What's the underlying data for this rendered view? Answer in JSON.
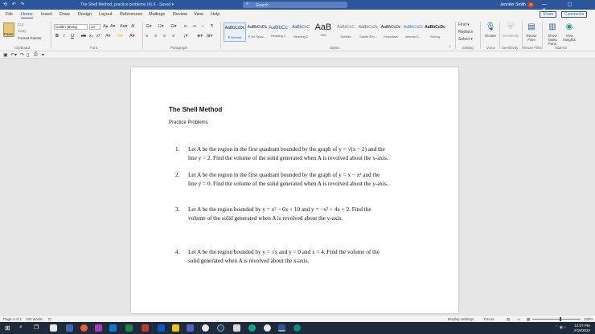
{
  "titlebar": {
    "quick_access": "⟲ ↶ ↷",
    "filename": "The Shell Method_practice problems (4).X  -  Saved ▾",
    "search_placeholder": "Search",
    "user": "Jennifer Smith",
    "avatar_initials": "JS",
    "window_buttons": "— ▢ ✕"
  },
  "menu_tabs": [
    "File",
    "Home",
    "Insert",
    "Draw",
    "Design",
    "Layout",
    "References",
    "Mailings",
    "Review",
    "View",
    "Help"
  ],
  "actions": {
    "share": "Share",
    "comments": "Comments"
  },
  "ribbon": {
    "clipboard": {
      "paste": "Paste",
      "cut": "Cut",
      "copy": "Copy",
      "format_painter": "Format Painter",
      "label": "Clipboard"
    },
    "font": {
      "name": "Calibri (Body)",
      "size": "12",
      "label": "Font",
      "format_buttons": [
        "B",
        "I",
        "U",
        "ab",
        "x₂",
        "x²"
      ]
    },
    "paragraph": {
      "label": "Paragraph"
    },
    "styles": {
      "label": "Styles",
      "items": [
        {
          "preview": "AaBbCcDc",
          "name": "¶ Normal"
        },
        {
          "preview": "AaBbCcDc",
          "name": "¶ No Spac..."
        },
        {
          "preview": "AaBbCc",
          "name": "Heading 1"
        },
        {
          "preview": "AaBbCcC",
          "name": "Heading 2"
        },
        {
          "preview": "AaB",
          "name": "Title"
        },
        {
          "preview": "AaBbCcC",
          "name": "Subtitle"
        },
        {
          "preview": "AaBbCcDc",
          "name": "Subtle Em..."
        },
        {
          "preview": "AaBbCcDc",
          "name": "Emphasis"
        },
        {
          "preview": "AaBbCcDc",
          "name": "Intense E..."
        },
        {
          "preview": "AaBbCcDc",
          "name": "Strong"
        }
      ]
    },
    "editing": {
      "find": "Find ▾",
      "replace": "Replace",
      "select": "Select ▾",
      "label": "Editing"
    },
    "voice": {
      "dictate": "Dictate",
      "label": "Voice"
    },
    "sensitivity": {
      "button": "Sensitivity",
      "label": "Sensitivity"
    },
    "reuse": {
      "button": "Reuse Files",
      "label": "Reuse Files"
    },
    "addins": {
      "show_tasks": "Show Tasks Pane",
      "viva": "Viva Insights",
      "label": "Add-ins"
    }
  },
  "document": {
    "title": "The Shell Method",
    "subtitle": "Practice Problems",
    "problems": [
      {
        "num": "1.",
        "line1": "Let A be the region in the first quadrant bounded by the graph of y = √(x − 2) and the",
        "line2": "line y = 2. Find the volume of the solid generated when A is revolved about the x-axis."
      },
      {
        "num": "2.",
        "line1": "Let A be the region in the first quadrant bounded by the graph of y = x − x² and the",
        "line2": "line y = 0. Find the volume of the solid generated when A is revolved about the y-axis."
      },
      {
        "num": "3.",
        "line1": "Let A be the region bounded by y = x² − 6x + 10 and y = −x² + 4x + 2. Find the",
        "line2": "volume of the solid generated when A is revolved about the y-axis."
      },
      {
        "num": "4.",
        "line1": "Let A be the region bounded by y = √x and y = 0 and x = 4.  Find the volume of the",
        "line2": "solid generated when A is revolved about the x-axis."
      }
    ]
  },
  "status": {
    "page": "Page 1 of 1",
    "words": "103 words",
    "display_settings": "Display Settings",
    "focus": "Focus",
    "zoom": "100%"
  },
  "taskbar": {
    "time": "12:07 PM",
    "date": "2/18/2022"
  }
}
